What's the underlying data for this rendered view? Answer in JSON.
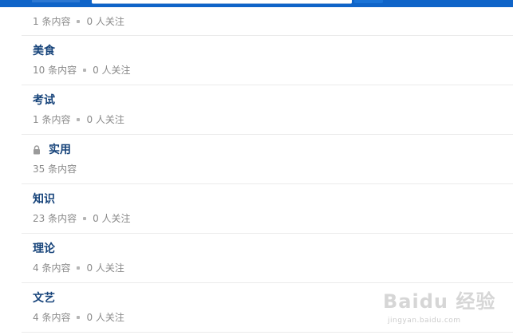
{
  "items": [
    {
      "title": "",
      "content_count": "1 条内容",
      "followers": "0 人关注"
    },
    {
      "title": "美食",
      "content_count": "10 条内容",
      "followers": "0 人关注"
    },
    {
      "title": "考试",
      "content_count": "1 条内容",
      "followers": "0 人关注"
    },
    {
      "title": "实用",
      "content_count": "35 条内容",
      "followers": "",
      "locked": true
    },
    {
      "title": "知识",
      "content_count": "23 条内容",
      "followers": "0 人关注"
    },
    {
      "title": "理论",
      "content_count": "4 条内容",
      "followers": "0 人关注"
    },
    {
      "title": "文艺",
      "content_count": "4 条内容",
      "followers": "0 人关注"
    }
  ],
  "watermark": {
    "brand": "Baidu 经验",
    "url": "jingyan.baidu.com"
  },
  "colors": {
    "topbar": "#0f64c8",
    "title": "#16437a",
    "meta": "#8a8a8a",
    "divider": "#ebebeb"
  },
  "icons": {
    "lock": "lock-icon"
  }
}
